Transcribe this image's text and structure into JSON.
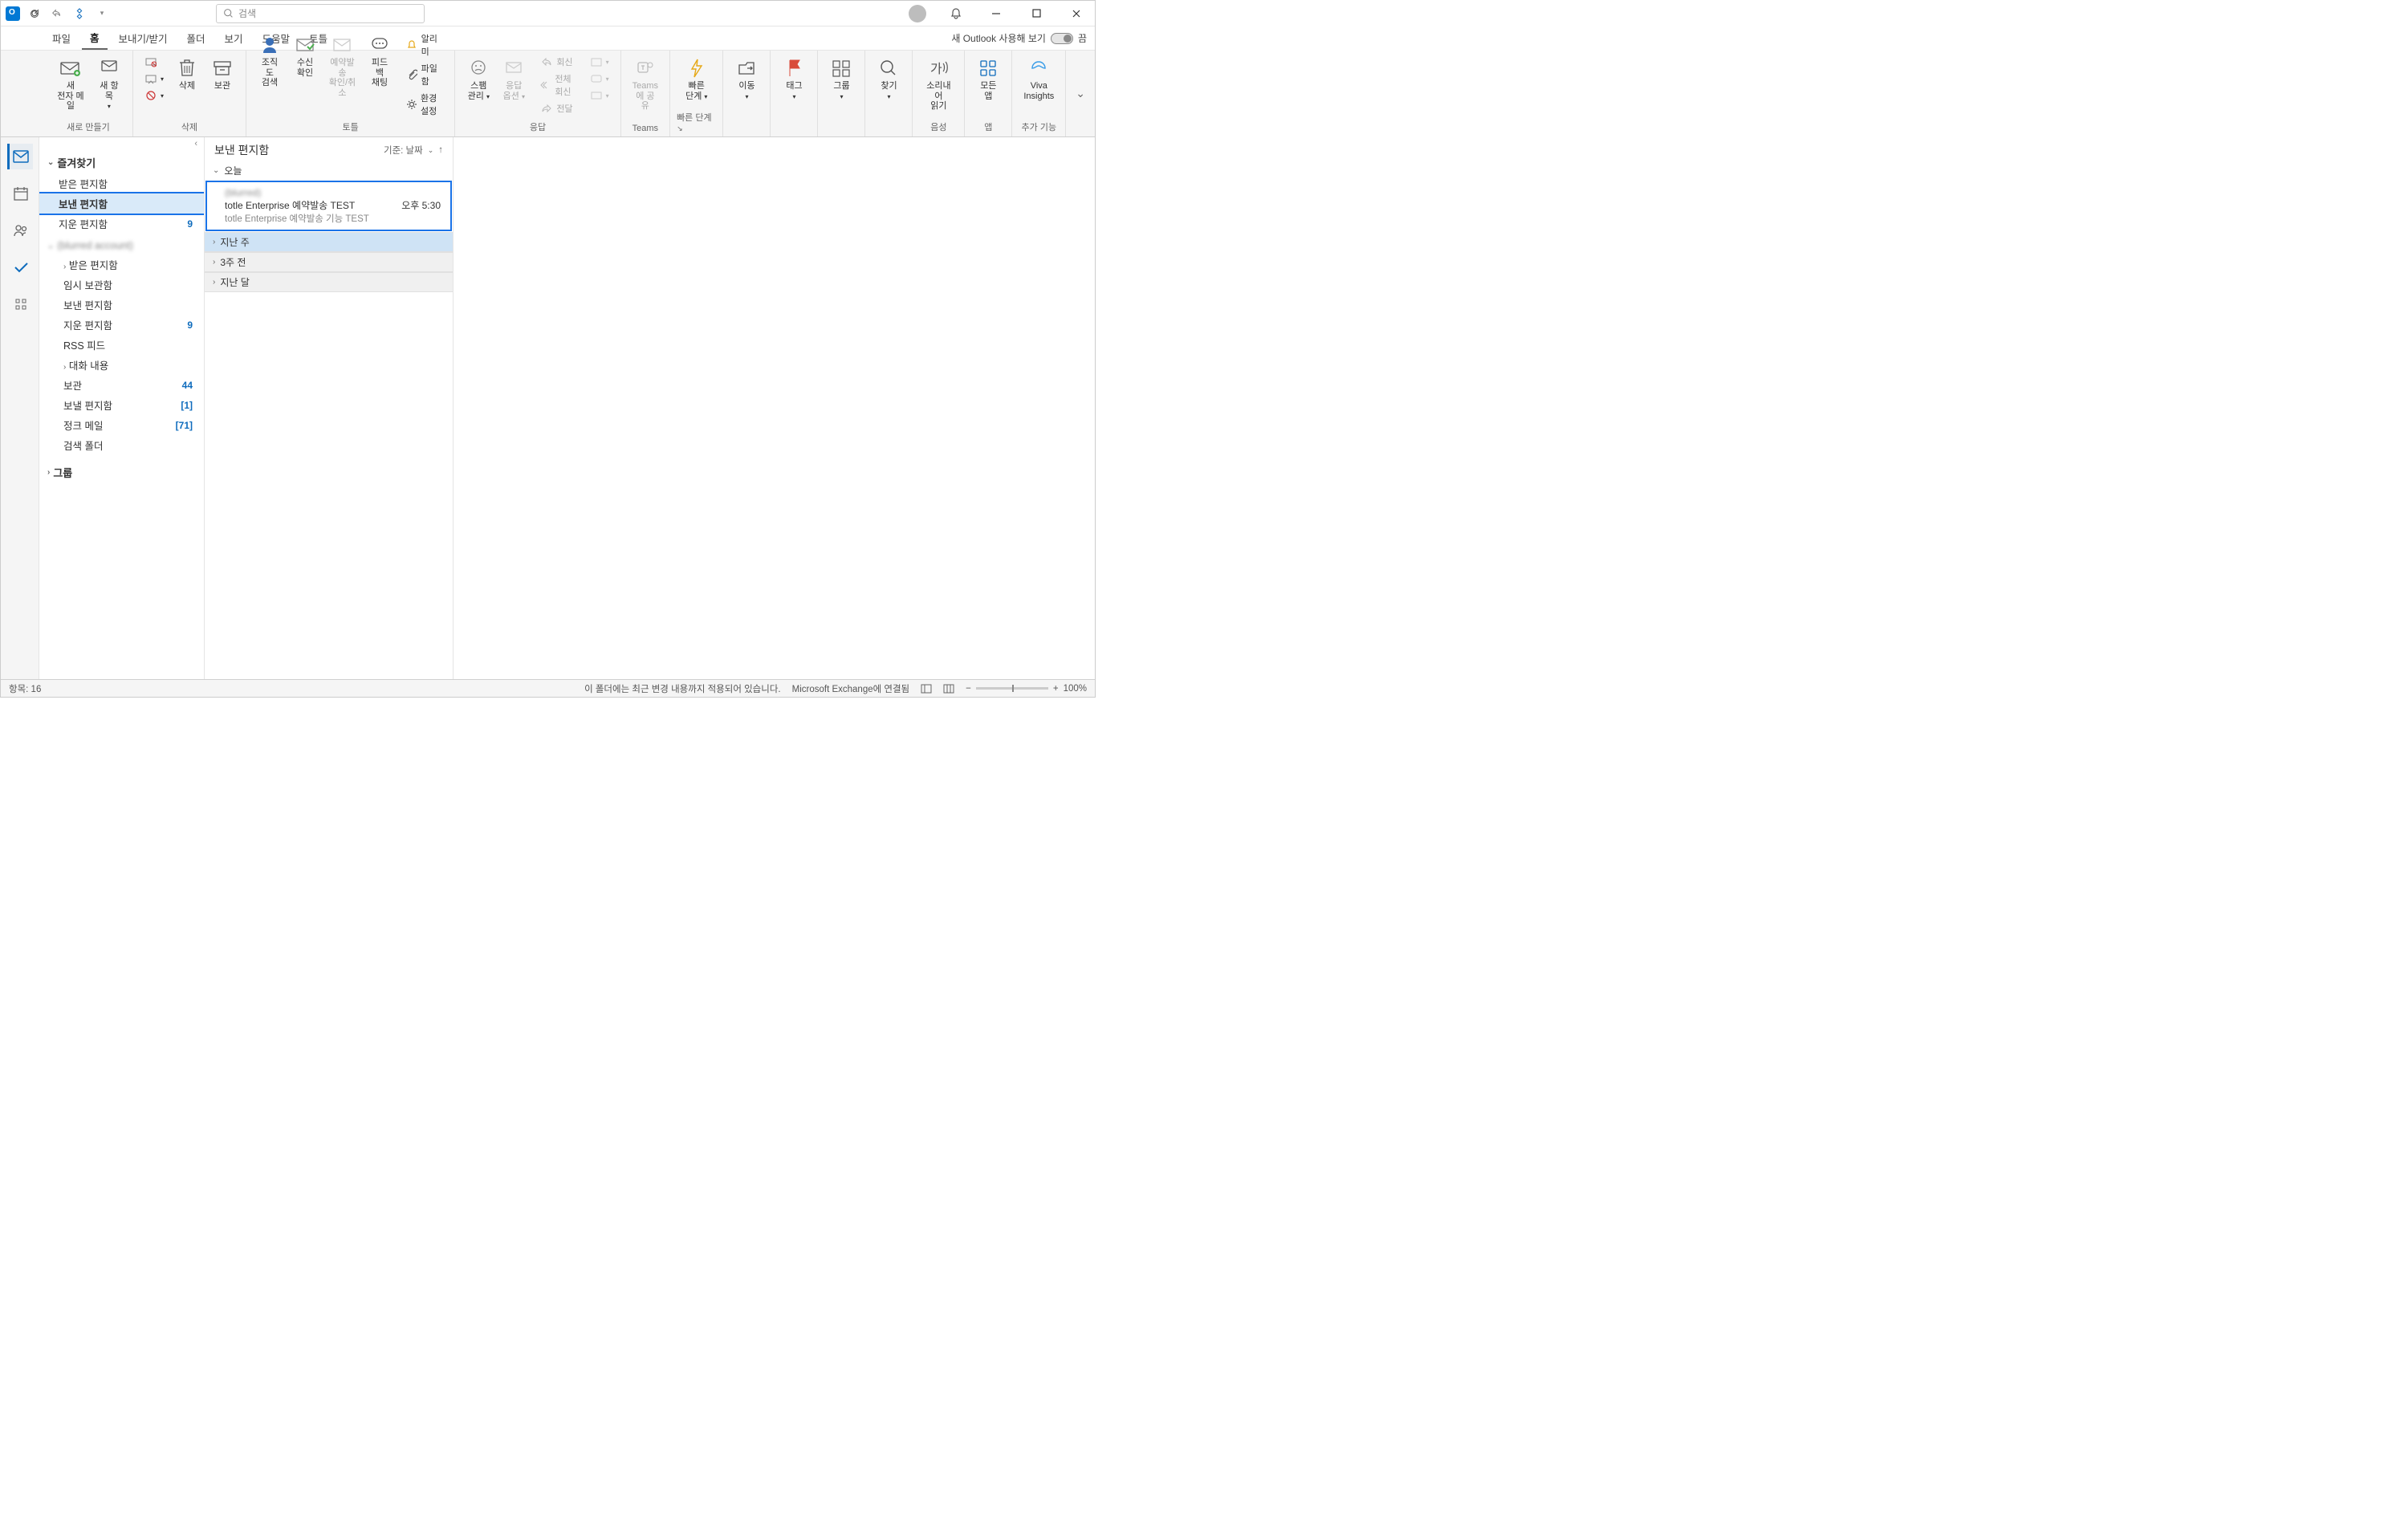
{
  "titlebar": {
    "search_placeholder": "검색",
    "new_outlook_label": "새 Outlook 사용해 보기",
    "toggle_state": "끔"
  },
  "menu": {
    "items": [
      "파일",
      "홈",
      "보내기/받기",
      "폴더",
      "보기",
      "도움말",
      "토틀"
    ],
    "active_index": 1
  },
  "ribbon": {
    "groups": [
      {
        "title": "새로 만들기",
        "buttons": [
          {
            "label": "새\n전자 메일",
            "icon": "new-mail"
          },
          {
            "label": "새 항목",
            "icon": "new-items",
            "dd": true
          }
        ]
      },
      {
        "title": "삭제",
        "buttons": [
          {
            "label": "",
            "icon": "ignore",
            "small": true
          },
          {
            "label": "",
            "icon": "cleanup",
            "small": true
          },
          {
            "label": "",
            "icon": "junk",
            "small": true
          },
          {
            "label": "삭제",
            "icon": "delete"
          },
          {
            "label": "보관",
            "icon": "archive"
          }
        ]
      },
      {
        "title": "토틀",
        "buttons": [
          {
            "label": "조직도\n검색",
            "icon": "org"
          },
          {
            "label": "수신\n확인",
            "icon": "receipt"
          },
          {
            "label": "예약발송\n확인/취소",
            "icon": "schedule",
            "disabled": true
          },
          {
            "label": "피드백\n채팅",
            "icon": "feedback"
          }
        ],
        "side": [
          {
            "label": "알리미",
            "icon": "bell"
          },
          {
            "label": "파일함",
            "icon": "attach"
          },
          {
            "label": "환경설정",
            "icon": "gear"
          }
        ]
      },
      {
        "title": "응답",
        "buttons": [
          {
            "label": "스팸\n관리",
            "icon": "spam",
            "dd": true
          },
          {
            "label": "응답\n옵션",
            "icon": "reply-opts",
            "disabled": true,
            "dd": true
          }
        ],
        "side": [
          {
            "label": "회신",
            "icon": "reply",
            "disabled": true
          },
          {
            "label": "전체 회신",
            "icon": "reply-all",
            "disabled": true
          },
          {
            "label": "전달",
            "icon": "forward",
            "disabled": true
          }
        ],
        "extra": true
      },
      {
        "title": "Teams",
        "buttons": [
          {
            "label": "Teams\n에 공유",
            "icon": "teams",
            "disabled": true
          }
        ]
      },
      {
        "title": "빠른 단계",
        "buttons": [
          {
            "label": "빠른\n단계",
            "icon": "quick",
            "dd": true
          }
        ],
        "launcher": true
      },
      {
        "title": "",
        "buttons": [
          {
            "label": "이동",
            "icon": "move",
            "dd": true
          }
        ]
      },
      {
        "title": "",
        "buttons": [
          {
            "label": "태그",
            "icon": "tags",
            "dd": true
          }
        ]
      },
      {
        "title": "",
        "buttons": [
          {
            "label": "그룹",
            "icon": "groups",
            "dd": true
          }
        ]
      },
      {
        "title": "",
        "buttons": [
          {
            "label": "찾기",
            "icon": "find",
            "dd": true
          }
        ]
      },
      {
        "title": "음성",
        "buttons": [
          {
            "label": "소리내어\n읽기",
            "icon": "read-aloud"
          }
        ]
      },
      {
        "title": "앱",
        "buttons": [
          {
            "label": "모든\n앱",
            "icon": "all-apps"
          }
        ]
      },
      {
        "title": "추가 기능",
        "buttons": [
          {
            "label": "Viva\nInsights",
            "icon": "viva"
          }
        ]
      }
    ]
  },
  "folders": {
    "favorites_title": "즐겨찾기",
    "favorites": [
      {
        "name": "받은 편지함",
        "count": null
      },
      {
        "name": "보낸 편지함",
        "count": null,
        "selected": true
      },
      {
        "name": "지운 편지함",
        "count": "9"
      }
    ],
    "account": "(blurred account)",
    "account_folders": [
      {
        "name": "받은 편지함",
        "count": null,
        "expandable": true
      },
      {
        "name": "임시 보관함",
        "count": null
      },
      {
        "name": "보낸 편지함",
        "count": null
      },
      {
        "name": "지운 편지함",
        "count": "9"
      },
      {
        "name": "RSS 피드",
        "count": null
      },
      {
        "name": "대화 내용",
        "count": null,
        "expandable": true
      },
      {
        "name": "보관",
        "count": "44"
      },
      {
        "name": "보낼 편지함",
        "count": "[1]"
      },
      {
        "name": "정크 메일",
        "count": "[71]"
      },
      {
        "name": "검색 폴더",
        "count": null
      }
    ],
    "groups_label": "그룹"
  },
  "list": {
    "title": "보낸 편지함",
    "sort_label": "기준: 날짜",
    "groups": [
      {
        "label": "오늘",
        "expanded": true,
        "items": [
          {
            "from": "(blurred)",
            "subject": "totle Enterprise 예약발송 TEST",
            "time": "오후 5:30",
            "preview": "totle Enterprise 예약발송 기능 TEST"
          }
        ]
      },
      {
        "label": "지난 주",
        "expanded": false,
        "hover": true
      },
      {
        "label": "3주 전",
        "expanded": false
      },
      {
        "label": "지난 달",
        "expanded": false
      }
    ]
  },
  "statusbar": {
    "item_count": "항목: 16",
    "sync_msg": "이 폴더에는 최근 변경 내용까지 적용되어 있습니다.",
    "connection": "Microsoft Exchange에 연결됨",
    "zoom": "100%"
  }
}
